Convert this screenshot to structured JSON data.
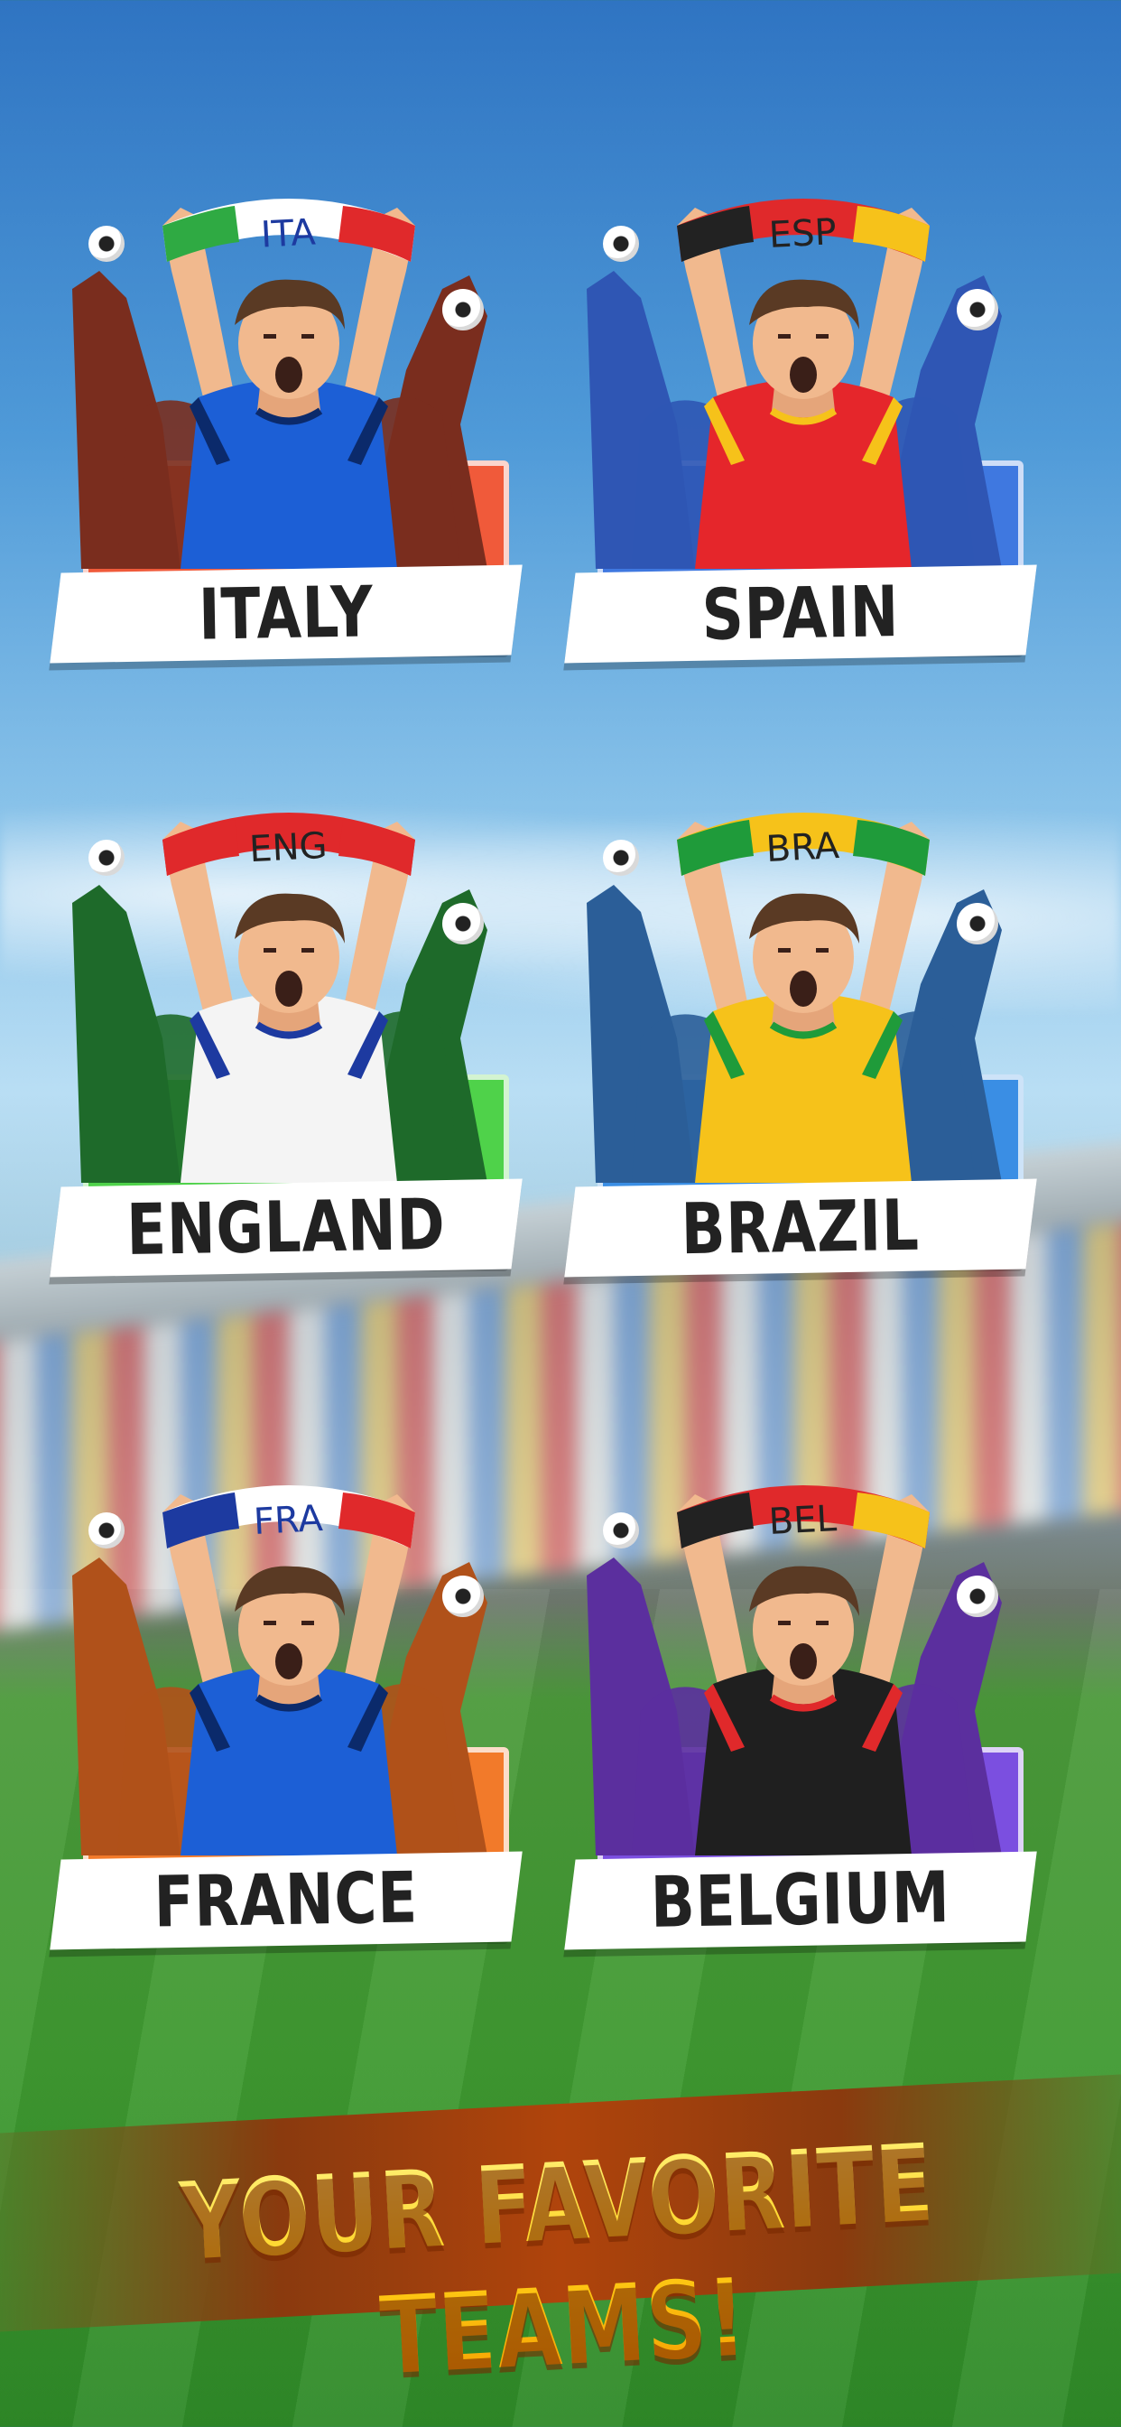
{
  "teams": [
    {
      "name": "ITALY",
      "code": "ITA",
      "panel": "#f05a3a",
      "crowd": "#7a2d1e",
      "shirt": "#1c5fd6",
      "trim": "#0b2a6b",
      "scarf": [
        "#2faa43",
        "#ffffff",
        "#e0292b"
      ]
    },
    {
      "name": "SPAIN",
      "code": "ESP",
      "panel": "#3f78e0",
      "crowd": "#2f56b4",
      "shirt": "#e5262b",
      "trim": "#f6c21a",
      "scarf": [
        "#222222",
        "#e0292b",
        "#f6c21a"
      ]
    },
    {
      "name": "ENGLAND",
      "code": "ENG",
      "panel": "#4fd24a",
      "crowd": "#1e6a2a",
      "shirt": "#f4f4f4",
      "trim": "#1d3aa0",
      "scarf": [
        "#e0292b",
        "#e0292b",
        "#e0292b"
      ]
    },
    {
      "name": "BRAZIL",
      "code": "BRA",
      "panel": "#3a8ee4",
      "crowd": "#2b5e98",
      "shirt": "#f6c21a",
      "trim": "#1f9b3a",
      "scarf": [
        "#1f9b3a",
        "#f6c21a",
        "#1f9b3a"
      ]
    },
    {
      "name": "FRANCE",
      "code": "FRA",
      "panel": "#f27a2a",
      "crowd": "#b0511a",
      "shirt": "#1c5fd6",
      "trim": "#0b2a6b",
      "scarf": [
        "#1d3aa0",
        "#ffffff",
        "#e0292b"
      ]
    },
    {
      "name": "BELGIUM",
      "code": "BEL",
      "panel": "#7b4fe0",
      "crowd": "#5b2f9e",
      "shirt": "#1f1f1f",
      "trim": "#e0292b",
      "scarf": [
        "#222222",
        "#e0292b",
        "#f6c21a"
      ]
    }
  ],
  "tagline": "YOUR FAVORITE TEAMS!"
}
